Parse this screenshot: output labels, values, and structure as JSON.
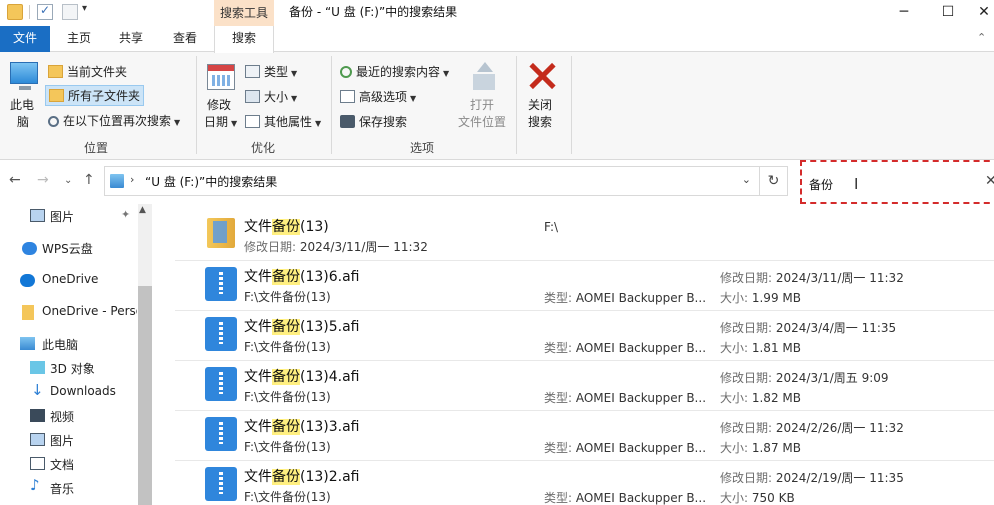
{
  "titlebar": {
    "context_tab": "搜索工具",
    "title": "备份 - “U 盘 (F:)”中的搜索结果",
    "minimize": "─",
    "maximize": "☐",
    "close": "✕"
  },
  "tabs": {
    "file": "文件",
    "home": "主页",
    "share": "共享",
    "view": "查看",
    "search": "搜索"
  },
  "ribbon": {
    "location": {
      "this_pc_line1": "此电",
      "this_pc_line2": "脑",
      "current_folder": "当前文件夹",
      "all_subfolders": "所有子文件夹",
      "search_again": "在以下位置再次搜索",
      "group_label": "位置"
    },
    "refine": {
      "date_line1": "修改",
      "date_line2": "日期",
      "kind": "类型",
      "size": "大小",
      "other_props": "其他属性",
      "group_label": "优化"
    },
    "options": {
      "recent": "最近的搜索内容",
      "advanced": "高级选项",
      "save_search": "保存搜索",
      "open_line1": "打开",
      "open_line2": "文件位置",
      "group_label": "选项"
    },
    "close_line1": "关闭",
    "close_line2": "搜索"
  },
  "address": {
    "path": "“U 盘 (F:)”中的搜索结果",
    "search_value": "备份"
  },
  "nav": [
    {
      "label": "图片"
    },
    {
      "label": "WPS云盘"
    },
    {
      "label": "OneDrive"
    },
    {
      "label": "OneDrive - Perso"
    },
    {
      "label": "此电脑"
    },
    {
      "label": "3D 对象"
    },
    {
      "label": "Downloads"
    },
    {
      "label": "视频"
    },
    {
      "label": "图片"
    },
    {
      "label": "文档"
    },
    {
      "label": "音乐"
    }
  ],
  "files": [
    {
      "pre": "文件",
      "hl": "备份",
      "post": "(13)",
      "sub_label": "修改日期: ",
      "sub_value": "2024/3/11/周一 11:32",
      "mid": "F:\\",
      "mid_label": "",
      "r1_label": "",
      "r1": "",
      "r2_label": "",
      "r2": ""
    },
    {
      "pre": "文件",
      "hl": "备份",
      "post": "(13)6.afi",
      "sub_label": "",
      "sub_value": "F:\\文件备份(13)",
      "mid_label": "类型: ",
      "mid": "AOMEI Backupper B...",
      "r1_label": "修改日期: ",
      "r1": "2024/3/11/周一 11:32",
      "r2_label": "大小: ",
      "r2": "1.99 MB"
    },
    {
      "pre": "文件",
      "hl": "备份",
      "post": "(13)5.afi",
      "sub_label": "",
      "sub_value": "F:\\文件备份(13)",
      "mid_label": "类型: ",
      "mid": "AOMEI Backupper B...",
      "r1_label": "修改日期: ",
      "r1": "2024/3/4/周一 11:35",
      "r2_label": "大小: ",
      "r2": "1.81 MB"
    },
    {
      "pre": "文件",
      "hl": "备份",
      "post": "(13)4.afi",
      "sub_label": "",
      "sub_value": "F:\\文件备份(13)",
      "mid_label": "类型: ",
      "mid": "AOMEI Backupper B...",
      "r1_label": "修改日期: ",
      "r1": "2024/3/1/周五 9:09",
      "r2_label": "大小: ",
      "r2": "1.82 MB"
    },
    {
      "pre": "文件",
      "hl": "备份",
      "post": "(13)3.afi",
      "sub_label": "",
      "sub_value": "F:\\文件备份(13)",
      "mid_label": "类型: ",
      "mid": "AOMEI Backupper B...",
      "r1_label": "修改日期: ",
      "r1": "2024/2/26/周一 11:32",
      "r2_label": "大小: ",
      "r2": "1.87 MB"
    },
    {
      "pre": "文件",
      "hl": "备份",
      "post": "(13)2.afi",
      "sub_label": "",
      "sub_value": "F:\\文件备份(13)",
      "mid_label": "类型: ",
      "mid": "AOMEI Backupper B...",
      "r1_label": "修改日期: ",
      "r1": "2024/2/19/周一 11:35",
      "r2_label": "大小: ",
      "r2": "750 KB"
    }
  ],
  "icons": {
    "back": "arrow-left-icon",
    "forward": "arrow-right-icon",
    "up": "arrow-up-icon",
    "refresh": "refresh-icon",
    "clear": "close-icon"
  },
  "colors": {
    "file_tab": "#1a6ec4",
    "context_tab": "#fbe1c8",
    "highlight": "#ffef80",
    "search_border": "#d42b2b"
  }
}
